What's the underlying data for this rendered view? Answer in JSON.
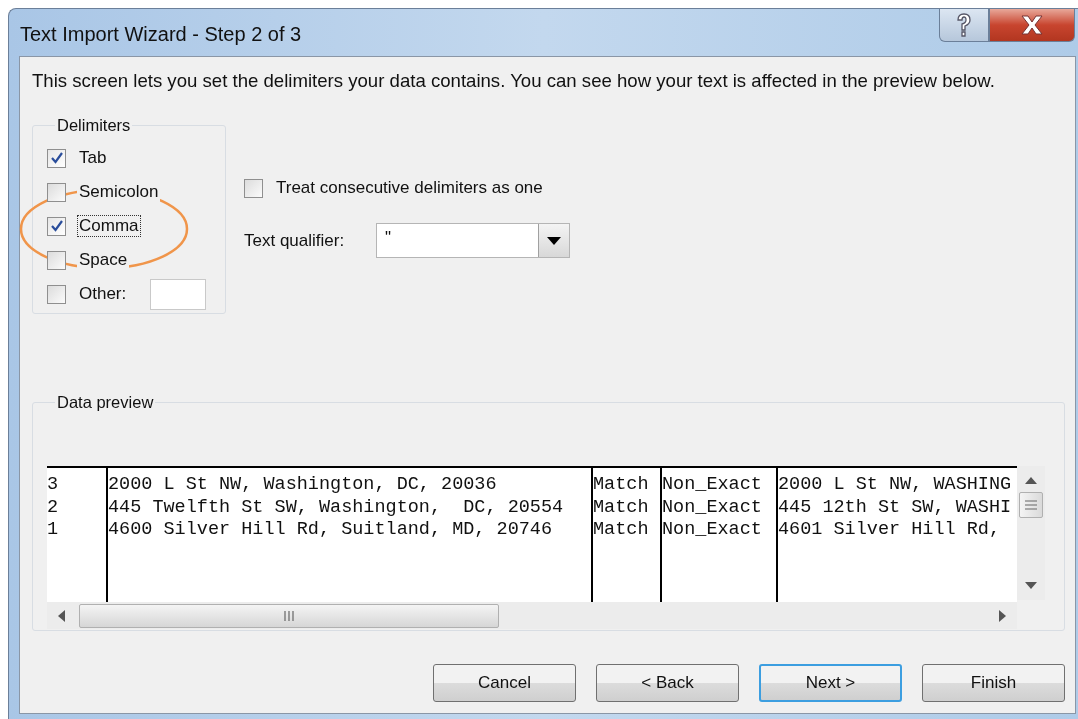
{
  "window": {
    "title": "Text Import Wizard - Step 2 of 3"
  },
  "description": "This screen lets you set the delimiters your data contains.  You can see how your text is affected in the preview below.",
  "delimiters": {
    "label": "Delimiters",
    "options": [
      {
        "label": "Tab",
        "checked": true
      },
      {
        "label": "Semicolon",
        "checked": false
      },
      {
        "label": "Comma",
        "checked": true,
        "focused": true
      },
      {
        "label": "Space",
        "checked": false
      },
      {
        "label": "Other:",
        "checked": false,
        "kind": "other"
      }
    ]
  },
  "consecutive": {
    "label": "Treat consecutive delimiters as one",
    "checked": false
  },
  "text_qualifier": {
    "label": "Text qualifier:",
    "value": "\""
  },
  "preview": {
    "label": "Data preview",
    "rows": [
      [
        "3",
        "2000 L St NW, Washington, DC, 20036",
        "Match",
        "Non_Exact",
        "2000 L St NW, WASHING"
      ],
      [
        "2",
        "445 Twelfth St SW, Washington,  DC, 20554",
        "Match",
        "Non_Exact",
        "445 12th St SW, WASHI"
      ],
      [
        "1",
        "4600 Silver Hill Rd, Suitland, MD, 20746",
        "Match",
        "Non_Exact",
        "4601 Silver Hill Rd,"
      ]
    ]
  },
  "buttons": [
    {
      "label": "Cancel",
      "default": false
    },
    {
      "label": "< Back",
      "default": false
    },
    {
      "label": "Next >",
      "default": true
    },
    {
      "label": "Finish",
      "default": false
    }
  ]
}
